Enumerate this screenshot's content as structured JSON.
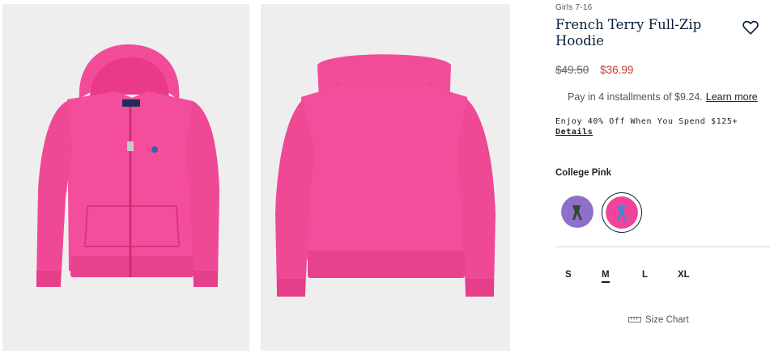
{
  "gallery": {
    "images": [
      {
        "label": "front",
        "icon": "hoodie-front-photo"
      },
      {
        "label": "back",
        "icon": "hoodie-back-photo"
      }
    ]
  },
  "product": {
    "category": "Girls 7-16",
    "title_line1": "French Terry Full-Zip",
    "title_line2": "Hoodie",
    "original_price": "$49.50",
    "sale_price": "$36.99",
    "installments_text": "Pay in 4 installments of $9.24.",
    "learn_more_label": "Learn more",
    "promo_text": "Enjoy 40% Off When You Spend $125+",
    "promo_link_label": "Details",
    "color_name": "College Pink",
    "swatches": [
      {
        "name": "purple",
        "color": "#8e6fc9"
      },
      {
        "name": "college-pink",
        "color": "#f0449a",
        "selected": true
      }
    ],
    "sizes": [
      "S",
      "M",
      "L",
      "XL"
    ],
    "selected_size": "M",
    "size_chart_label": "Size Chart"
  },
  "colors": {
    "hoodie_pink": "#f44d9b",
    "title_navy": "#041e3a",
    "sale_red": "#c0392b",
    "logo_blue": "#3a5fb0"
  }
}
